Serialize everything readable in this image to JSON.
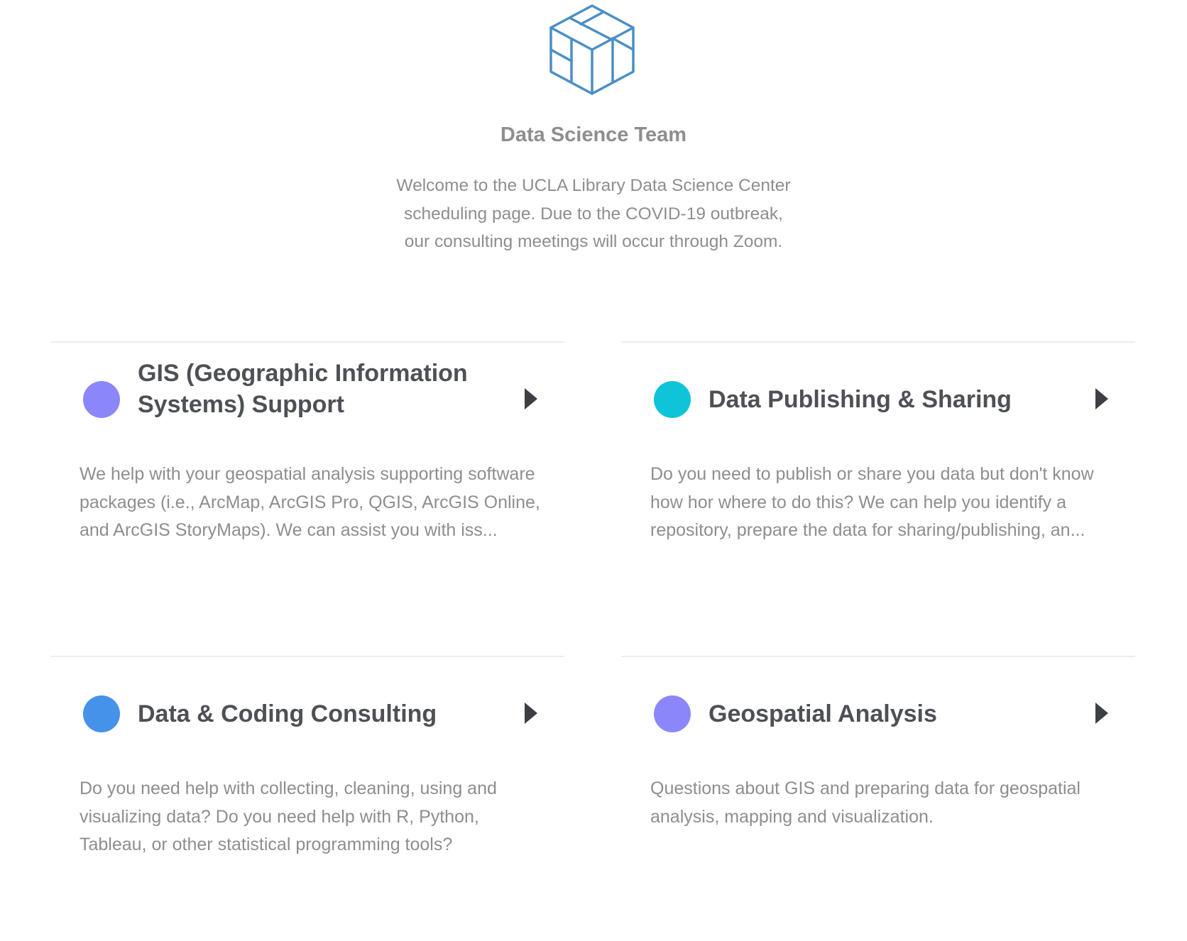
{
  "header": {
    "logo_icon": "data-science-cube-logo",
    "team_name": "Data Science Team",
    "welcome_text": "Welcome to the UCLA Library Data Science Center scheduling page. Due to the COVID-19 outbreak, our consulting meetings will occur through Zoom."
  },
  "colors": {
    "logo_stroke": "#4a8fc4",
    "divider": "#ececec",
    "title_text": "#4d5055",
    "body_text": "#8e8e8e",
    "arrow": "#3c3f44"
  },
  "cards": [
    {
      "title": "GIS (Geographic Information Systems) Support",
      "description": "We help with your geospatial analysis supporting software packages (i.e., ArcMap, ArcGIS Pro, QGIS, ArcGIS Online, and ArcGIS StoryMaps). We can assist you with iss...",
      "dot_color": "#8b87fb",
      "arrow_icon": "caret-right-icon"
    },
    {
      "title": "Data Publishing & Sharing",
      "description": "Do you need to publish or share you data but don't know how hor where to do this? We can help you identify a repository, prepare the data for sharing/publishing, an...",
      "dot_color": "#0fc4d8",
      "arrow_icon": "caret-right-icon"
    },
    {
      "title": "Data & Coding Consulting",
      "description": "Do you need help with collecting, cleaning, using and visualizing data? Do you need help with R, Python, Tableau, or other statistical programming tools?",
      "dot_color": "#4492ea",
      "arrow_icon": "caret-right-icon"
    },
    {
      "title": "Geospatial Analysis",
      "description": "Questions about GIS and preparing data for geospatial analysis, mapping and visualization.",
      "dot_color": "#8b87fb",
      "arrow_icon": "caret-right-icon"
    }
  ]
}
